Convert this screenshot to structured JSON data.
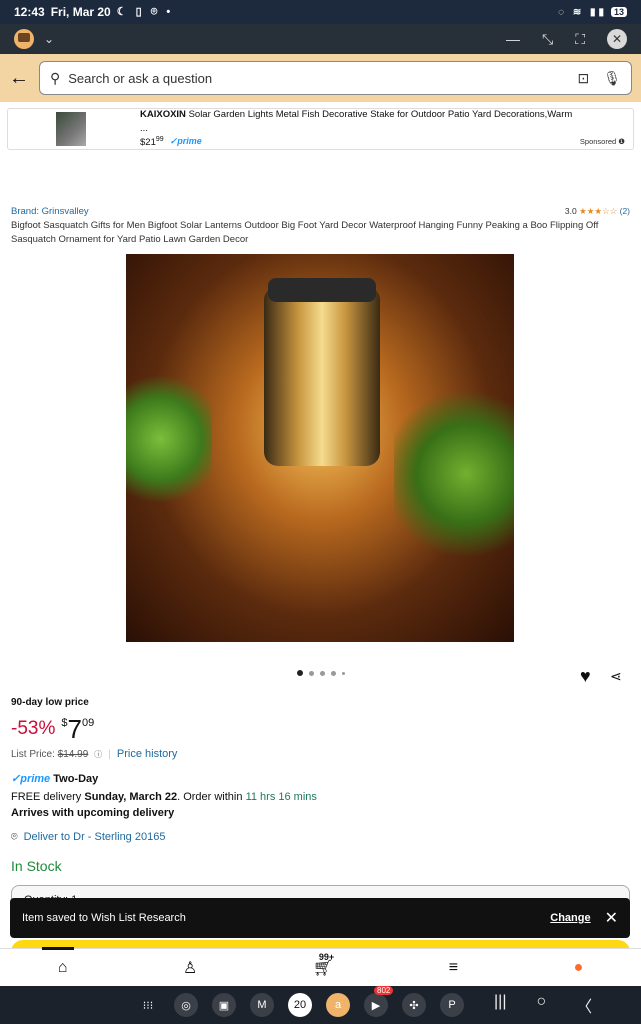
{
  "status_bar": {
    "time": "12:43",
    "date": "Fri, Mar 20",
    "battery": "13"
  },
  "window": {
    "app_icon": "amazon-shopping-icon",
    "controls": [
      "minimize-icon",
      "restore-icon",
      "fullscreen-icon",
      "close-icon"
    ]
  },
  "search": {
    "placeholder": "Search or ask a question"
  },
  "ad": {
    "brand": "KAIXOXIN",
    "title": "Solar Garden Lights Metal Fish Decorative Stake for Outdoor Patio Yard Decorations,Warm ...",
    "price_dollars": "$21",
    "price_cents": "99",
    "prime": "prime",
    "sponsored": "Sponsored"
  },
  "product": {
    "brand": "Brand: Grinsvalley",
    "rating_value": "3.0",
    "rating_stars": "★★★☆☆",
    "rating_count": "(2)",
    "title": "Bigfoot Sasquatch Gifts for Men Bigfoot Solar Lanterns Outdoor Big Foot Yard Decor Waterproof Hanging Funny Peaking a Boo Flipping Off Sasquatch Ornament for Yard Patio Lawn Garden Decor",
    "image_pagination": {
      "total": 5,
      "active": 1
    },
    "deal_label": "90-day low price",
    "discount": "-53%",
    "currency": "$",
    "price_whole": "7",
    "price_cents": "09",
    "list_price_label": "List Price:",
    "list_price": "$14.99",
    "price_history": "Price history",
    "prime_label": "prime",
    "prime_speed": "Two-Day",
    "free_delivery": "FREE delivery",
    "delivery_date": "Sunday, March 22",
    "order_within": ". Order within",
    "time_left": "11 hrs 16 mins",
    "arrives": "Arrives with upcoming delivery",
    "deliver_to": "Deliver to Dr - Sterling 20165",
    "stock": "In Stock",
    "quantity_label": "Quantity: 1"
  },
  "toast": {
    "message": "Item saved to Wish List Research",
    "action": "Change"
  },
  "tabbar": {
    "items": [
      "home-icon",
      "account-icon",
      "cart-icon",
      "menu-icon",
      "rufus-icon"
    ],
    "cart_count": "99+"
  },
  "system_nav": {
    "apps": [
      "apps-grid-icon",
      "chrome-icon",
      "camera-icon",
      "gmail-icon",
      "calendar-icon",
      "amazon-icon",
      "youtube-icon",
      "slack-icon",
      "pinterest-icon"
    ],
    "calendar_day": "20",
    "youtube_badge": "802"
  }
}
